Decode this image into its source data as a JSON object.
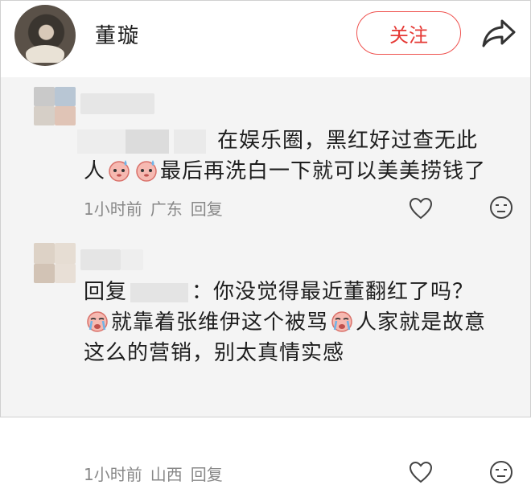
{
  "header": {
    "username": "董璇",
    "follow_label": "关注"
  },
  "comments": [
    {
      "text_before": "在娱乐圈，黑红好过查无此",
      "text_line2_start": "人",
      "text_line2_end": "最后再洗白一下就可以美美捞钱了",
      "time": "1小时前",
      "location": "广东",
      "reply_label": "回复"
    },
    {
      "reply_prefix": "回复",
      "after_name": "：你没觉得最近董翻红了吗？",
      "line2_a": "就靠着张维伊这个被骂",
      "line2_b": "人家就是故意",
      "line3": "这么的营销，别太真情实感",
      "time": "1小时前",
      "location": "山西",
      "reply_label": "回复"
    }
  ],
  "colors": {
    "accent": "#e53935",
    "background": "#f4f4f4",
    "meta_text": "#888888"
  },
  "icons": [
    "share-icon",
    "like-icon",
    "dislike-icon",
    "crying-emoji",
    "sweat-emoji"
  ]
}
